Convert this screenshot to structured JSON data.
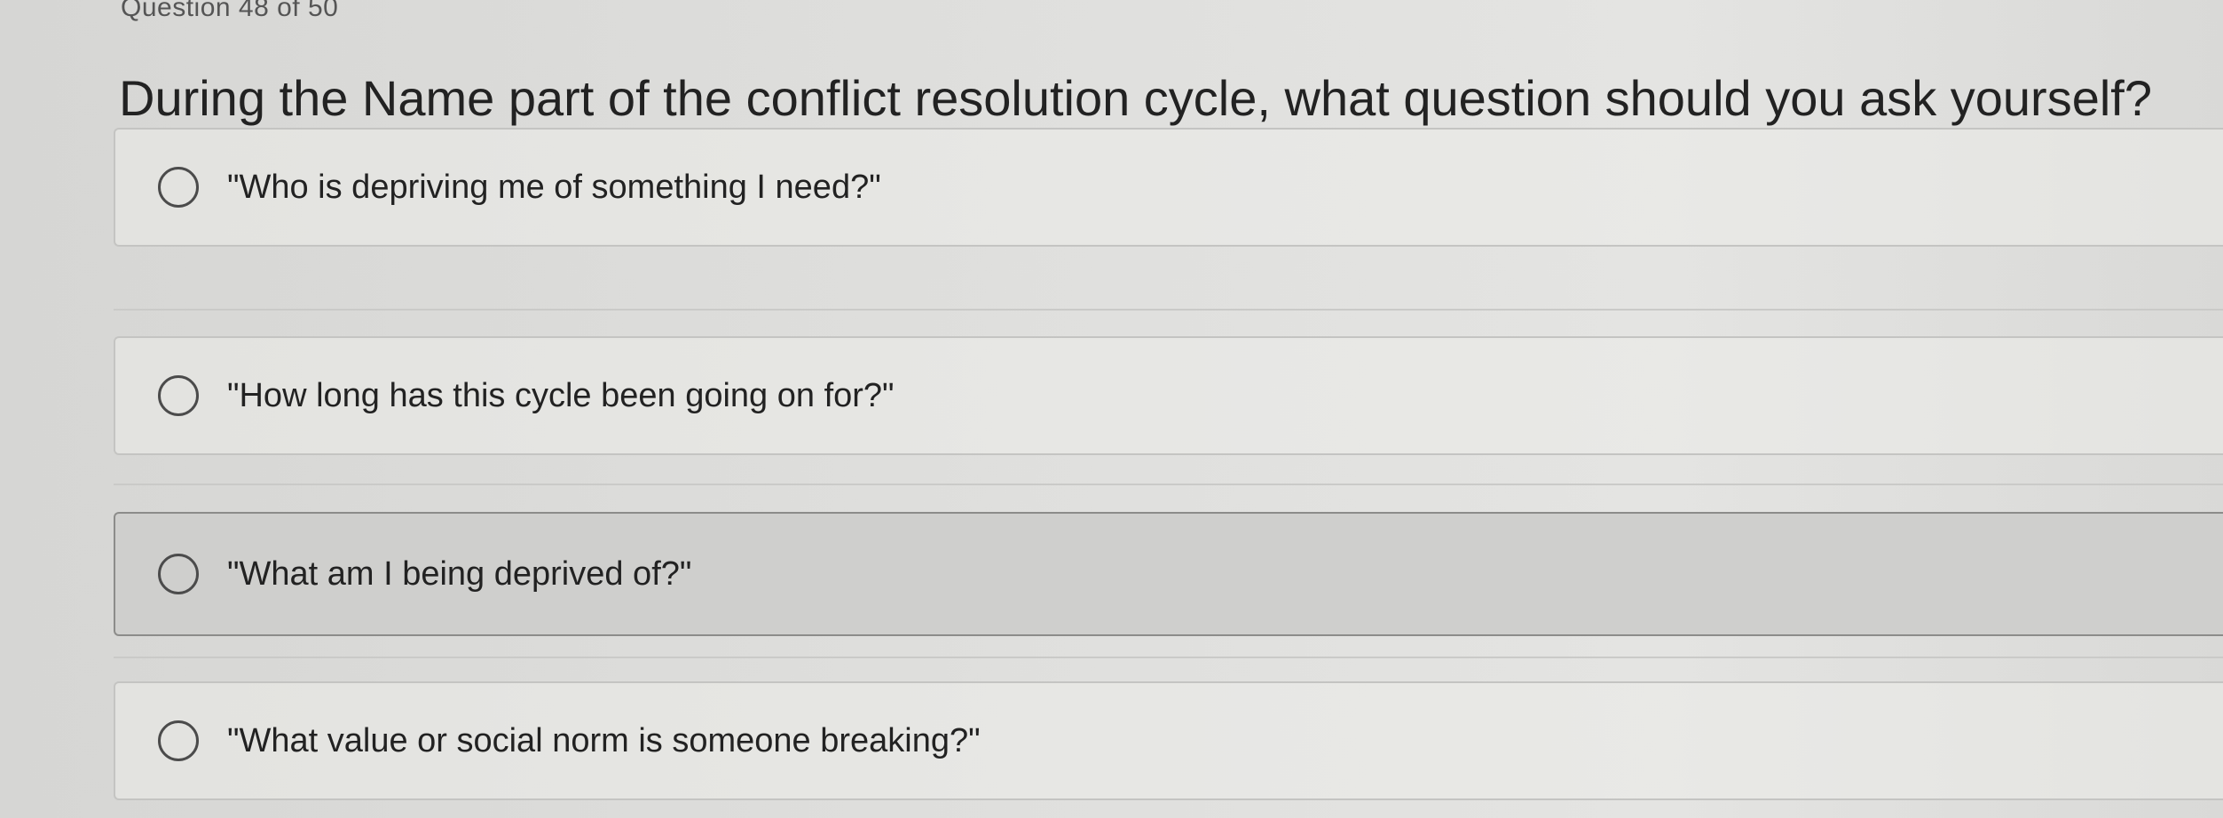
{
  "quiz": {
    "counter": "Question 48 of 50",
    "question": "During the Name part of the conflict resolution cycle, what question should you ask yourself?",
    "options": [
      {
        "label": "\"Who is depriving me of something I need?\"",
        "selected": false
      },
      {
        "label": "\"How long has this cycle been going on for?\"",
        "selected": false
      },
      {
        "label": "\"What am I being deprived of?\"",
        "selected": false
      },
      {
        "label": "\"What value or social norm is someone breaking?\"",
        "selected": false
      }
    ]
  }
}
